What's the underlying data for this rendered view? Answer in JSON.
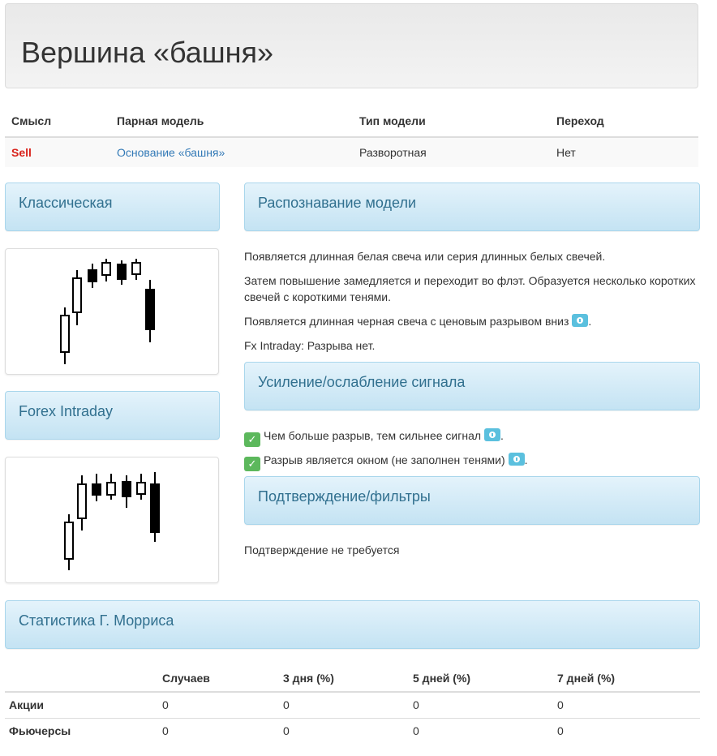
{
  "page": {
    "title": "Вершина «башня»"
  },
  "info_table": {
    "headers": [
      "Смысл",
      "Парная модель",
      "Тип модели",
      "Переход"
    ],
    "row": {
      "signal": "Sell",
      "pair_model": "Основание «башня»",
      "model_type": "Разворотная",
      "transition": "Нет"
    }
  },
  "panels": {
    "classic": "Классическая",
    "forex": "Forex Intraday",
    "recognition": "Распознавание модели",
    "strength": "Усиление/ослабление сигнала",
    "confirmation": "Подтверждение/фильтры",
    "statistics": "Статистика Г. Морриса"
  },
  "recognition_text": [
    "Появляется длинная белая свеча или серия длинных белых свечей.",
    "Затем повышение замедляется и переходит во флэт. Образуется несколько коротких свечей с короткими тенями.",
    "Появляется длинная черная свеча с ценовым разрывом вниз",
    "Fx Intraday: Разрыва нет."
  ],
  "strength_items": [
    "Чем больше разрыв, тем сильнее сигнал",
    "Разрыв является окном (не заполнен тенями)"
  ],
  "confirmation_text": "Подтверждение не требуется",
  "stats_table": {
    "headers": [
      "",
      "Случаев",
      "3 дня (%)",
      "5 дней (%)",
      "7 дней (%)"
    ],
    "rows": [
      {
        "label": "Акции",
        "values": [
          "0",
          "0",
          "0",
          "0"
        ]
      },
      {
        "label": "Фьючерсы",
        "values": [
          "0",
          "0",
          "0",
          "0"
        ]
      }
    ]
  },
  "icons": {
    "check": "check-icon",
    "info": "info-icon"
  },
  "colors": {
    "sell": "#d9231c",
    "link": "#337ab7",
    "panel_text": "#31708f",
    "check_bg": "#5cb85c",
    "info_bg": "#5bc0de"
  }
}
